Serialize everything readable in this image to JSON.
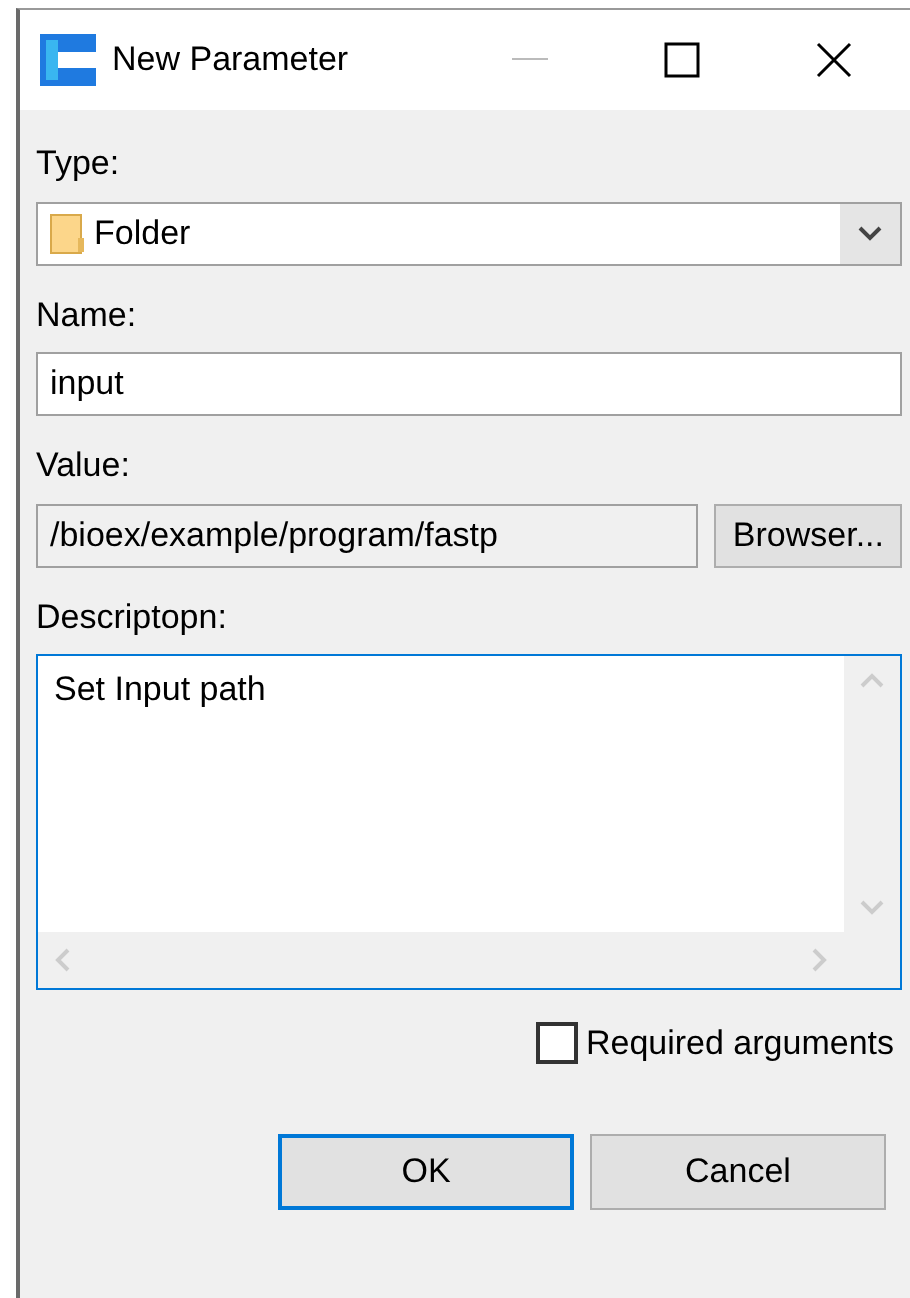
{
  "window": {
    "title": "New Parameter"
  },
  "type": {
    "label": "Type:",
    "value": "Folder"
  },
  "name": {
    "label": "Name:",
    "value": "input"
  },
  "value": {
    "label": "Value:",
    "value": "/bioex/example/program/fastp",
    "readonly": true,
    "browse_button": "Browser..."
  },
  "description": {
    "label": "Descriptopn:",
    "value": "Set Input path",
    "focused": true
  },
  "required": {
    "label": "Required arguments",
    "checked": false
  },
  "buttons": [
    {
      "label": "OK",
      "default": true
    },
    {
      "label": "Cancel",
      "default": false
    }
  ]
}
